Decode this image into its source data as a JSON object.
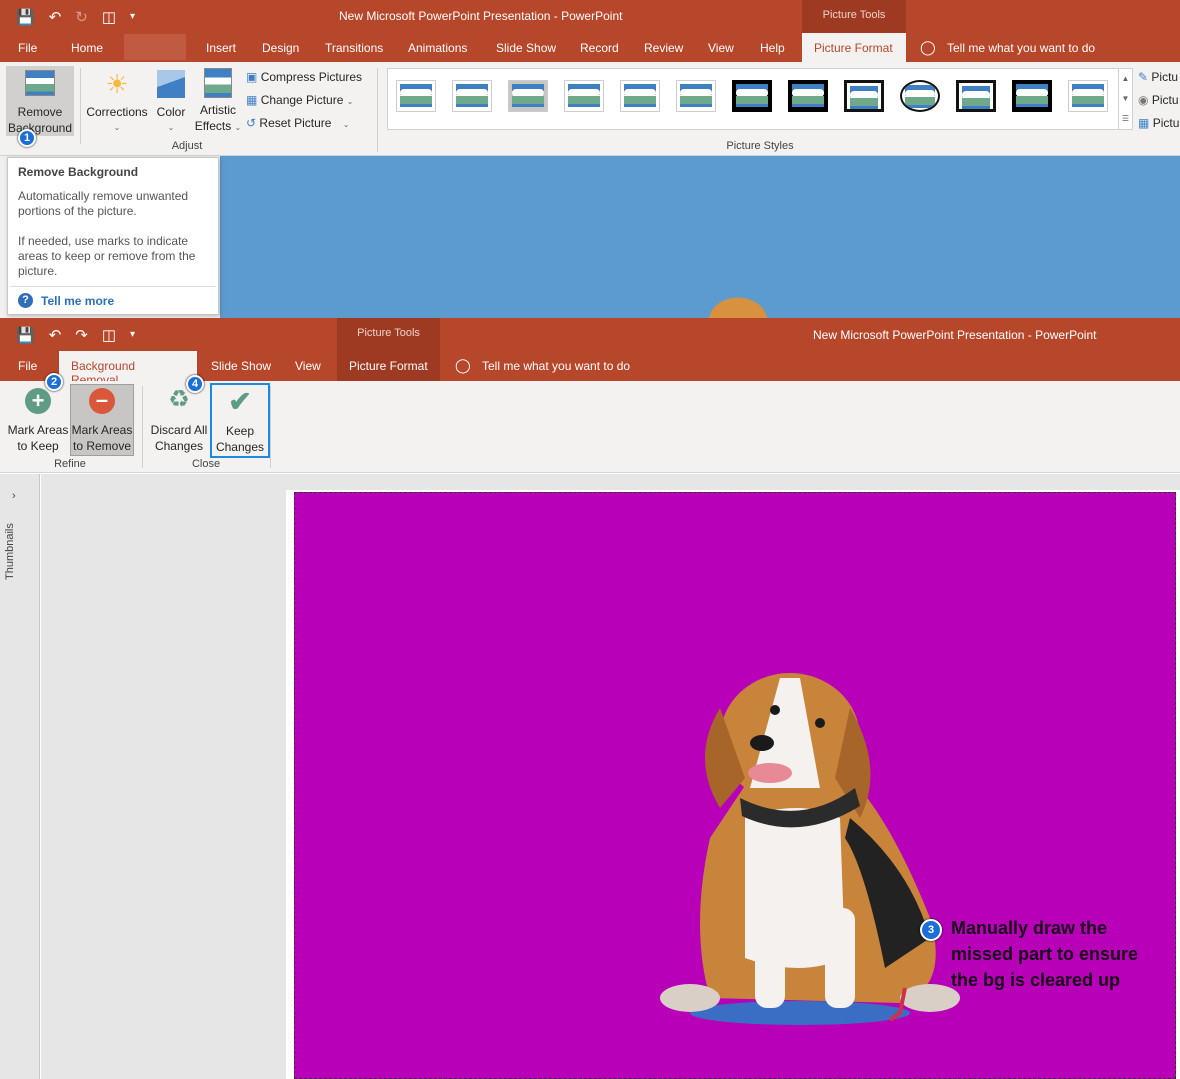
{
  "window1": {
    "title": "New Microsoft PowerPoint Presentation  -  PowerPoint",
    "context_tab_group": "Picture Tools",
    "tabs": [
      "File",
      "Home",
      "Insert",
      "Design",
      "Transitions",
      "Animations",
      "Slide Show",
      "Record",
      "Review",
      "View",
      "Help",
      "Picture Format"
    ],
    "active_tab": "Picture Format",
    "tell_me": "Tell me what you want to do",
    "ribbon": {
      "remove_background": "Remove Background",
      "remove_background_l1": "Remove",
      "remove_background_l2": "Background",
      "corrections": "Corrections",
      "color": "Color",
      "artistic_effects_l1": "Artistic",
      "artistic_effects_l2": "Effects",
      "compress_pictures": "Compress Pictures",
      "change_picture": "Change Picture",
      "reset_picture": "Reset Picture",
      "adjust_group": "Adjust",
      "picture_styles_group": "Picture Styles",
      "picture_border": "Pictu",
      "picture_effects": "Pictu",
      "picture_layout": "Pictu",
      "style_count": 13
    }
  },
  "tooltip": {
    "title": "Remove Background",
    "line1": "Automatically remove unwanted portions of the picture.",
    "line2": "If needed, use marks to indicate areas to keep or remove from the picture.",
    "link": "Tell me more"
  },
  "window2": {
    "title": "New Microsoft PowerPoint Presentation  -  PowerPoint",
    "context_tab_group": "Picture Tools",
    "tabs": [
      "File",
      "Background Removal",
      "Slide Show",
      "View",
      "Picture Format"
    ],
    "active_tab": "Background Removal",
    "tell_me": "Tell me what you want to do",
    "ribbon": {
      "mark_keep_l1": "Mark Areas",
      "mark_keep_l2": "to Keep",
      "mark_remove_l1": "Mark Areas",
      "mark_remove_l2": "to Remove",
      "discard_l1": "Discard All",
      "discard_l2": "Changes",
      "keep_l1": "Keep",
      "keep_l2": "Changes",
      "refine_group": "Refine",
      "close_group": "Close"
    },
    "thumbnails_label": "Thumbnails"
  },
  "annotations": {
    "step1": "1",
    "step2": "2",
    "step3": "3",
    "step4": "4",
    "step3_text_l1": "Manually draw the",
    "step3_text_l2": "missed part to ensure",
    "step3_text_l3": "the bg is cleared up"
  },
  "colors": {
    "ppt_red": "#b7472a",
    "context_dark": "#9e3a22",
    "removal_magenta": "#b800b8",
    "slide_blue": "#5b9bd0",
    "badge_blue": "#1b6fd6",
    "highlight_border": "#1e88e5"
  }
}
